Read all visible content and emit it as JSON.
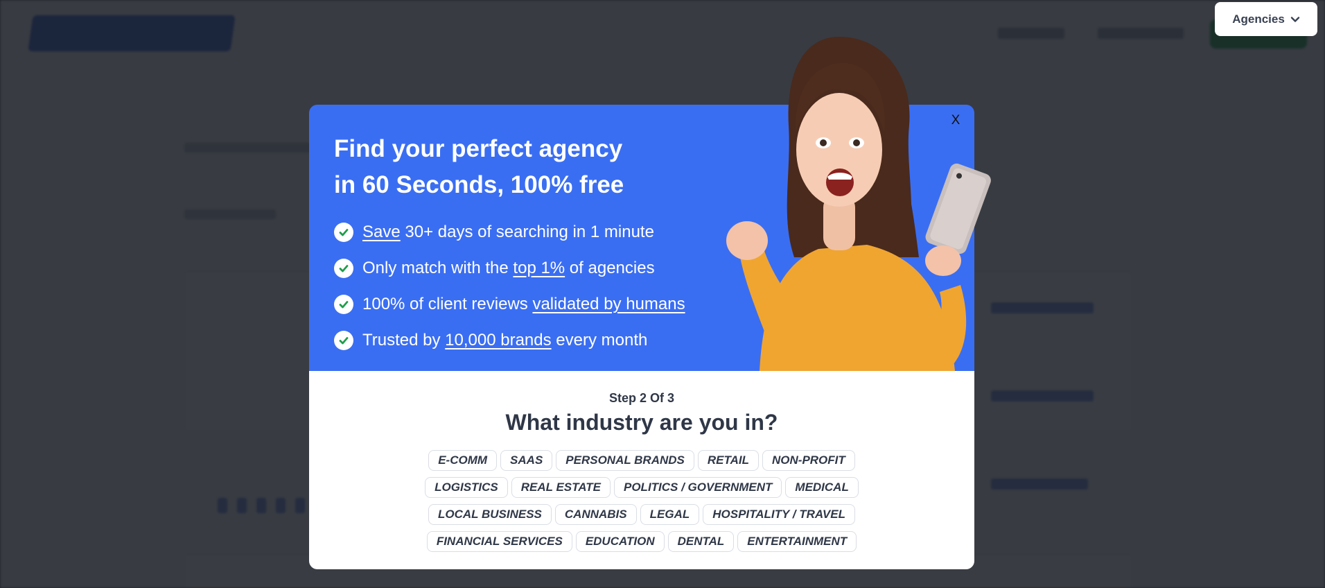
{
  "header": {
    "agencies_label": "Agencies"
  },
  "modal": {
    "close_label": "X",
    "headline_line1": "Find your perfect agency",
    "headline_line2": "in 60 Seconds, 100% free",
    "features": [
      {
        "before": "",
        "link": "Save",
        "after": " 30+ days of searching in 1 minute"
      },
      {
        "before": "Only match with the ",
        "link": "top 1%",
        "after": " of agencies"
      },
      {
        "before": "100% of client reviews ",
        "link": "validated by humans",
        "after": ""
      },
      {
        "before": "Trusted by ",
        "link": "10,000 brands",
        "after": " every month"
      }
    ],
    "step_label": "Step 2 Of 3",
    "question": "What industry are you in?",
    "industry_rows": [
      [
        "E-COMM",
        "SAAS",
        "PERSONAL BRANDS",
        "RETAIL",
        "NON-PROFIT"
      ],
      [
        "LOGISTICS",
        "REAL ESTATE",
        "POLITICS / GOVERNMENT",
        "MEDICAL"
      ],
      [
        "LOCAL BUSINESS",
        "CANNABIS",
        "LEGAL",
        "HOSPITALITY / TRAVEL"
      ],
      [
        "FINANCIAL SERVICES",
        "EDUCATION",
        "DENTAL",
        "ENTERTAINMENT"
      ]
    ]
  },
  "colors": {
    "modal_blue": "#3a6ef2",
    "overlay": "#23262e",
    "text_dark": "#2f3747",
    "check_green": "#1d9e4a",
    "sweater": "#f0a531"
  }
}
